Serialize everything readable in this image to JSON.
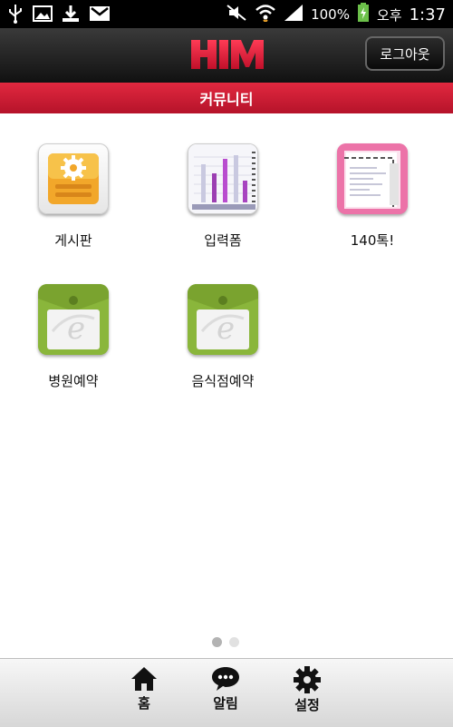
{
  "status_bar": {
    "icons": [
      "usb-icon",
      "image-icon",
      "download-icon",
      "gmail-icon",
      "mute-icon",
      "wifi-icon",
      "signal-icon",
      "battery-charging-icon"
    ],
    "battery": "100%",
    "ampm": "오후",
    "time": "1:37"
  },
  "header": {
    "logo": "HIM",
    "logout_label": "로그아웃",
    "title": "커뮤니티"
  },
  "apps": [
    {
      "label": "게시판",
      "icon": "board-icon"
    },
    {
      "label": "입력폼",
      "icon": "input-form-chart-icon"
    },
    {
      "label": "140톡!",
      "icon": "talk-140-icon"
    },
    {
      "label": "병원예약",
      "icon": "hospital-reservation-icon"
    },
    {
      "label": "음식점예약",
      "icon": "restaurant-reservation-icon"
    }
  ],
  "pager": {
    "pages": 2,
    "current": 1
  },
  "tabbar": {
    "home_label": "홈",
    "alert_label": "알림",
    "settings_label": "설정"
  },
  "colors": {
    "accent_red": "#c8183a",
    "board_orange": "#f2a72a",
    "talk_pink": "#e9679e",
    "reserve_green": "#8ab63b"
  }
}
